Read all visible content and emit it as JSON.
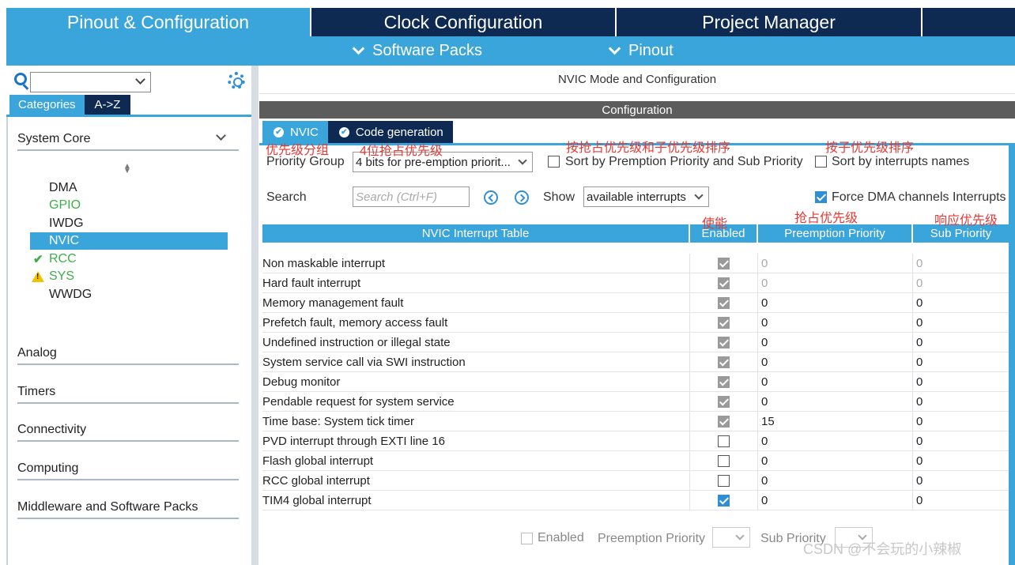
{
  "top_tabs": [
    "Pinout & Configuration",
    "Clock Configuration",
    "Project Manager",
    ""
  ],
  "sub_menu": {
    "software_packs": "Software Packs",
    "pinout": "Pinout"
  },
  "left": {
    "search_placeholder": "",
    "tabs": {
      "categories": "Categories",
      "atoz": "A->Z"
    },
    "groups": {
      "system_core": "System Core",
      "analog": "Analog",
      "timers": "Timers",
      "connectivity": "Connectivity",
      "computing": "Computing",
      "middleware": "Middleware and Software Packs"
    },
    "items": [
      {
        "label": "DMA",
        "status": "none"
      },
      {
        "label": "GPIO",
        "status": "green"
      },
      {
        "label": "IWDG",
        "status": "none"
      },
      {
        "label": "NVIC",
        "status": "selected"
      },
      {
        "label": "RCC",
        "status": "ok"
      },
      {
        "label": "SYS",
        "status": "warning"
      },
      {
        "label": "WWDG",
        "status": "none"
      }
    ]
  },
  "right": {
    "mode_title": "NVIC Mode and Configuration",
    "configuration": "Configuration",
    "tabs": {
      "nvic": "NVIC",
      "codegen": "Code generation"
    },
    "priority_group_label": "Priority Group",
    "priority_group_value": "4 bits for pre-emption priorit...",
    "sort_premption": "Sort by Premption Priority and Sub Priority",
    "sort_names": "Sort by interrupts names",
    "search_label": "Search",
    "search_placeholder": "Search (Ctrl+F)",
    "show_label": "Show",
    "show_value": "available interrupts",
    "force_dma": "Force DMA channels Interrupts",
    "table_headers": {
      "name": "NVIC Interrupt Table",
      "enabled": "Enabled",
      "preemption": "Preemption Priority",
      "sub": "Sub Priority"
    },
    "rows": [
      {
        "name": "Non maskable interrupt",
        "enabled": "locked",
        "pp": "0",
        "sp": "0",
        "editable": false
      },
      {
        "name": "Hard fault interrupt",
        "enabled": "locked",
        "pp": "0",
        "sp": "0",
        "editable": false
      },
      {
        "name": "Memory management fault",
        "enabled": "locked",
        "pp": "0",
        "sp": "0",
        "editable": true
      },
      {
        "name": "Prefetch fault, memory access fault",
        "enabled": "locked",
        "pp": "0",
        "sp": "0",
        "editable": true
      },
      {
        "name": "Undefined instruction or illegal state",
        "enabled": "locked",
        "pp": "0",
        "sp": "0",
        "editable": true
      },
      {
        "name": "System service call via SWI instruction",
        "enabled": "locked",
        "pp": "0",
        "sp": "0",
        "editable": true
      },
      {
        "name": "Debug monitor",
        "enabled": "locked",
        "pp": "0",
        "sp": "0",
        "editable": true
      },
      {
        "name": "Pendable request for system service",
        "enabled": "locked",
        "pp": "0",
        "sp": "0",
        "editable": true
      },
      {
        "name": "Time base: System tick timer",
        "enabled": "locked",
        "pp": "15",
        "sp": "0",
        "editable": true
      },
      {
        "name": "PVD interrupt through EXTI line 16",
        "enabled": "off",
        "pp": "0",
        "sp": "0",
        "editable": true
      },
      {
        "name": "Flash global interrupt",
        "enabled": "off",
        "pp": "0",
        "sp": "0",
        "editable": true
      },
      {
        "name": "RCC global interrupt",
        "enabled": "off",
        "pp": "0",
        "sp": "0",
        "editable": true
      },
      {
        "name": "TIM4 global interrupt",
        "enabled": "on",
        "pp": "0",
        "sp": "0",
        "editable": true
      }
    ],
    "bottom": {
      "enabled": "Enabled",
      "preemption": "Preemption Priority",
      "sub": "Sub Priority"
    }
  },
  "annotations": {
    "priority_group": "优先级分组",
    "bits": "4位抢占优先级",
    "sort_pp": "按抢占优先级和子优先级排序",
    "sort_sub": "按子优先级排序",
    "enable": "使能",
    "preempt": "抢占优先级",
    "response": "响应优先级"
  },
  "watermark": "CSDN @不会玩的小辣椒",
  "colors": {
    "accent": "#3aa5db",
    "navy": "#0e2a52",
    "annotation": "#e53935"
  }
}
